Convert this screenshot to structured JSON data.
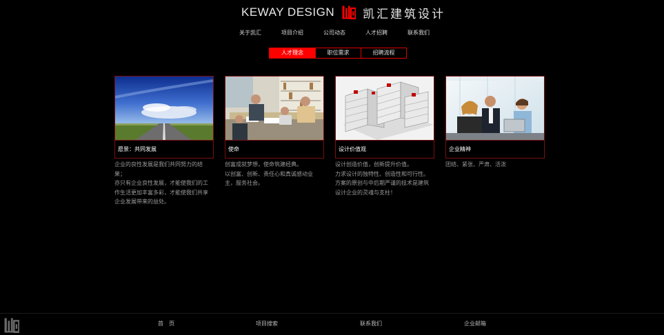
{
  "brand": {
    "name_en": "KEWAY DESIGN",
    "name_cn": "凯汇建筑设计",
    "accent": "#ff0000"
  },
  "nav": [
    "关于凯汇",
    "项目介绍",
    "公司动态",
    "人才招聘",
    "联系我们"
  ],
  "tabs": [
    "人才理念",
    "职位需求",
    "招聘流程"
  ],
  "active_tab": "人才理念",
  "cards": [
    {
      "title": "愿景：共同发展",
      "lines": [
        "企业的良性发展是我们共同努力的结",
        "果；",
        "亦只有企业良性发展，才能使我们的工",
        "作生活更加丰富多彩，才能使我们共享",
        "企业发展带来的益处。"
      ]
    },
    {
      "title": "使命",
      "lines": [
        "创富成就梦想，使命筑建经典。",
        "以创富、创新、责任心和真诚感动业",
        "主，服务社会。"
      ]
    },
    {
      "title": "设计价值观",
      "lines": [
        "设计创造价值，创新提升价值。",
        "力求设计的独特性、创造性和可行性。",
        "方案的原创与中后期严谨的技术是建筑",
        "设计企业的灵魂与支柱！"
      ]
    },
    {
      "title": "企业精神",
      "lines": [
        "团结、紧张、严肃、活泼"
      ]
    }
  ],
  "footer": {
    "links": [
      "首　页",
      "项目搜索",
      "联系我们",
      "企业邮箱"
    ]
  }
}
